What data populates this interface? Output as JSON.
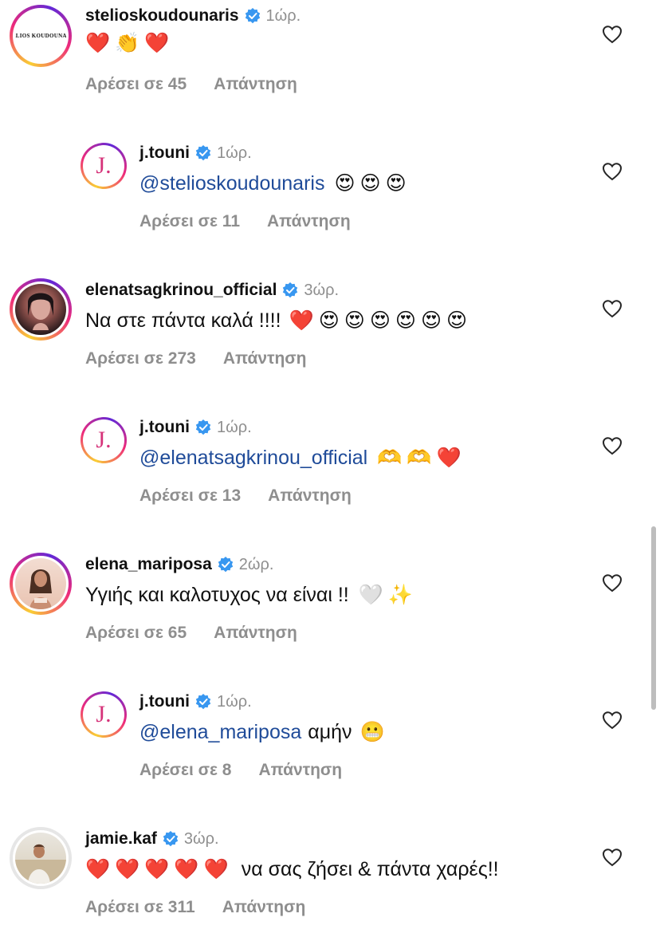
{
  "comments": [
    {
      "username": "stelioskoudounaris",
      "time": "1ώρ.",
      "text": "",
      "emojis": [
        "❤️",
        "👏",
        "❤️"
      ],
      "likes": "Αρέσει σε 45",
      "reply": "Απάντηση",
      "avatar_text": "STELIOS KOUDOUNARIS"
    },
    {
      "username": "j.touni",
      "time": "1ώρ.",
      "mention": "@stelioskoudounaris",
      "emojis": [
        "😍",
        "😍",
        "😍"
      ],
      "likes": "Αρέσει σε 11",
      "reply": "Απάντηση",
      "avatar_text": "J."
    },
    {
      "username": "elenatsagkrinou_official",
      "time": "3ώρ.",
      "text": "Να στε πάντα καλά !!!!",
      "emojis": [
        "❤️",
        "😍",
        "😍",
        "😍",
        "😍",
        "😍",
        "😍"
      ],
      "likes": "Αρέσει σε 273",
      "reply": "Απάντηση"
    },
    {
      "username": "j.touni",
      "time": "1ώρ.",
      "mention": "@elenatsagkrinou_official",
      "emojis": [
        "🫶",
        "🫶",
        "❤️"
      ],
      "likes": "Αρέσει σε 13",
      "reply": "Απάντηση",
      "avatar_text": "J."
    },
    {
      "username": "elena_mariposa",
      "time": "2ώρ.",
      "text": "Υγιής και καλοτυχος να είναι !!",
      "emojis": [
        "🤍",
        "✨"
      ],
      "likes": "Αρέσει σε 65",
      "reply": "Απάντηση"
    },
    {
      "username": "j.touni",
      "time": "1ώρ.",
      "mention": "@elena_mariposa",
      "text_after": "αμήν",
      "emojis": [
        "😬"
      ],
      "likes": "Αρέσει σε 8",
      "reply": "Απάντηση",
      "avatar_text": "J."
    },
    {
      "username": "jamie.kaf",
      "time": "3ώρ.",
      "emojis": [
        "❤️",
        "❤️",
        "❤️",
        "❤️",
        "❤️"
      ],
      "text_after": "να σας ζήσει & πάντα χαρές!!",
      "likes": "Αρέσει σε 311",
      "reply": "Απάντηση"
    }
  ],
  "icons": {
    "verified": "verified-badge-icon",
    "like": "heart-outline-icon"
  },
  "colors": {
    "verified": "#3897f0",
    "meta_gray": "#8e8e8e",
    "mention": "#1f4b99"
  }
}
